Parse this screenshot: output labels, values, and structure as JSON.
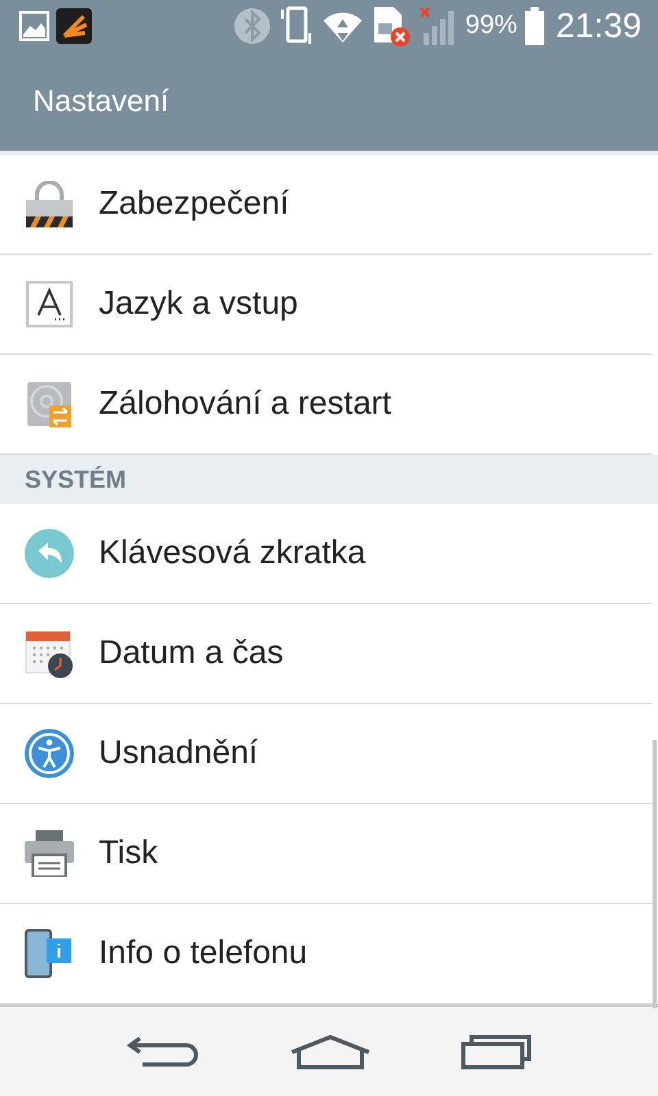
{
  "status_bar": {
    "battery": "99%",
    "time": "21:39"
  },
  "app_bar": {
    "title": "Nastavení"
  },
  "sections": [
    {
      "items": [
        {
          "kind": "lock",
          "label": "Zabezpečení"
        },
        {
          "kind": "language",
          "label": "Jazyk a vstup"
        },
        {
          "kind": "backup",
          "label": "Zálohování a restart"
        }
      ]
    },
    {
      "header": "SYSTÉM",
      "items": [
        {
          "kind": "shortcut",
          "label": "Klávesová zkratka"
        },
        {
          "kind": "datetime",
          "label": "Datum a čas"
        },
        {
          "kind": "accessibility",
          "label": "Usnadnění"
        },
        {
          "kind": "print",
          "label": "Tisk"
        },
        {
          "kind": "info",
          "label": "Info o telefonu"
        }
      ]
    }
  ]
}
